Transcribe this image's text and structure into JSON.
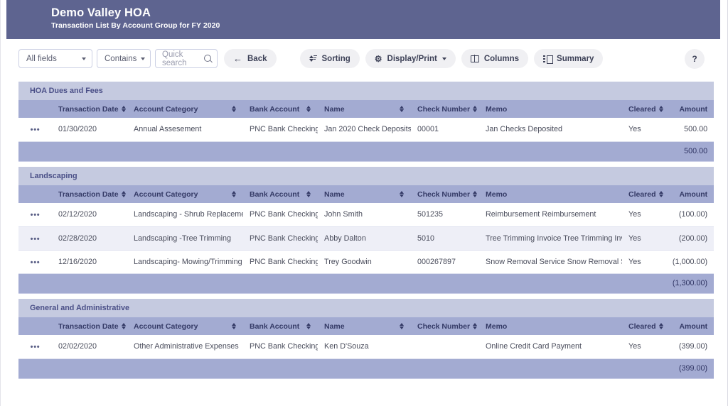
{
  "header": {
    "title": "Demo Valley HOA",
    "subtitle": "Transaction List By Account Group for FY 2020",
    "bg_color": "#5e6490"
  },
  "toolbar": {
    "field_select_value": "All fields",
    "operator_select_value": "Contains",
    "search_placeholder": "Quick search",
    "search_value": "",
    "back_label": "Back",
    "sorting_label": "Sorting",
    "display_print_label": "Display/Print",
    "columns_label": "Columns",
    "summary_label": "Summary",
    "help_label": "?",
    "icons": {
      "search": "search-icon",
      "back": "arrow-left-icon",
      "sorting": "sort-icon",
      "display": "gear-icon",
      "columns": "columns-icon",
      "summary": "summary-icon",
      "dropdown": "chevron-down-icon"
    }
  },
  "table": {
    "columns": [
      {
        "key": "menu",
        "label": "",
        "sortable": false,
        "align": "center"
      },
      {
        "key": "date",
        "label": "Transaction Date",
        "sortable": true,
        "align": "left"
      },
      {
        "key": "cat",
        "label": "Account Category",
        "sortable": true,
        "align": "left"
      },
      {
        "key": "bank",
        "label": "Bank Account",
        "sortable": true,
        "align": "left"
      },
      {
        "key": "name",
        "label": "Name",
        "sortable": true,
        "align": "left"
      },
      {
        "key": "check",
        "label": "Check Number",
        "sortable": true,
        "align": "left"
      },
      {
        "key": "memo",
        "label": "Memo",
        "sortable": false,
        "align": "left"
      },
      {
        "key": "clear",
        "label": "Cleared",
        "sortable": true,
        "align": "left"
      },
      {
        "key": "amt",
        "label": "Amount",
        "sortable": false,
        "align": "right"
      }
    ],
    "row_menu_glyph": "•••",
    "groups": [
      {
        "name": "HOA Dues and Fees",
        "rows": [
          {
            "date": "01/30/2020",
            "cat": "Annual Assesement",
            "bank": "PNC Bank Checking",
            "name": "Jan 2020 Check Deposits",
            "check": "00001",
            "memo": "Jan Checks Deposited",
            "clear": "Yes",
            "amt": "500.00"
          }
        ],
        "subtotal": "500.00"
      },
      {
        "name": "Landscaping",
        "rows": [
          {
            "date": "02/12/2020",
            "cat": "Landscaping - Shrub Replacement",
            "bank": "PNC Bank Checking",
            "name": "John Smith",
            "check": "501235",
            "memo": "Reimbursement Reimbursement",
            "clear": "Yes",
            "amt": "(100.00)"
          },
          {
            "date": "02/28/2020",
            "cat": "Landscaping -Tree Trimming",
            "bank": "PNC Bank Checking",
            "name": "Abby Dalton",
            "check": "5010",
            "memo": "Tree Trimming Invoice Tree Trimming Invoice",
            "clear": "Yes",
            "amt": "(200.00)"
          },
          {
            "date": "12/16/2020",
            "cat": "Landscaping- Mowing/Trimming",
            "bank": "PNC Bank Checking",
            "name": "Trey Goodwin",
            "check": "000267897",
            "memo": "Snow Removal Service Snow Removal Service",
            "clear": "Yes",
            "amt": "(1,000.00)"
          }
        ],
        "subtotal": "(1,300.00)"
      },
      {
        "name": "General and Administrative",
        "rows": [
          {
            "date": "02/02/2020",
            "cat": "Other Administrative Expenses",
            "bank": "PNC Bank Checking",
            "name": "Ken D'Souza",
            "check": "",
            "memo": "Online Credit Card Payment",
            "clear": "Yes",
            "amt": "(399.00)"
          }
        ],
        "subtotal": "(399.00)"
      }
    ]
  },
  "colors": {
    "header_bar": "#5e6490",
    "group_band": "#c5cae0",
    "column_header": "#a3abd2",
    "row_alt": "#eeeff7",
    "subtotal_band": "#a3abd2"
  }
}
